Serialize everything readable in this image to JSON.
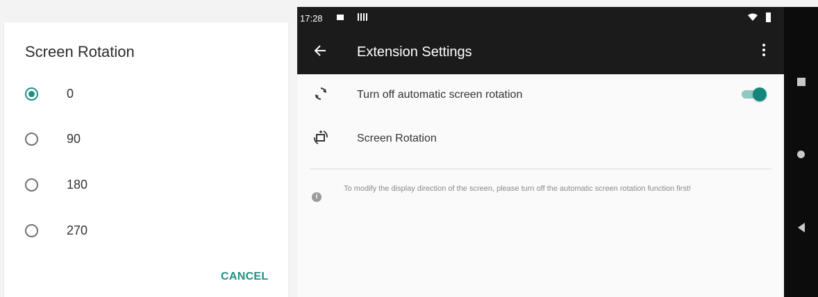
{
  "dialog": {
    "title": "Screen Rotation",
    "options": [
      {
        "label": "0",
        "checked": true
      },
      {
        "label": "90",
        "checked": false
      },
      {
        "label": "180",
        "checked": false
      },
      {
        "label": "270",
        "checked": false
      }
    ],
    "cancel_label": "CANCEL"
  },
  "status_bar": {
    "time": "17:28"
  },
  "app_bar": {
    "title": "Extension Settings"
  },
  "settings": {
    "auto_rotation": {
      "label": "Turn off automatic screen rotation",
      "icon": "rotate-icon",
      "enabled": true
    },
    "screen_rotation": {
      "label": "Screen Rotation",
      "icon": "screen-rotation-icon"
    },
    "info": {
      "text": "To modify the display direction of the screen, please turn off the automatic screen rotation function first!"
    }
  },
  "colors": {
    "accent": "#1f8f86",
    "app_bar": "#1b1b1b"
  }
}
